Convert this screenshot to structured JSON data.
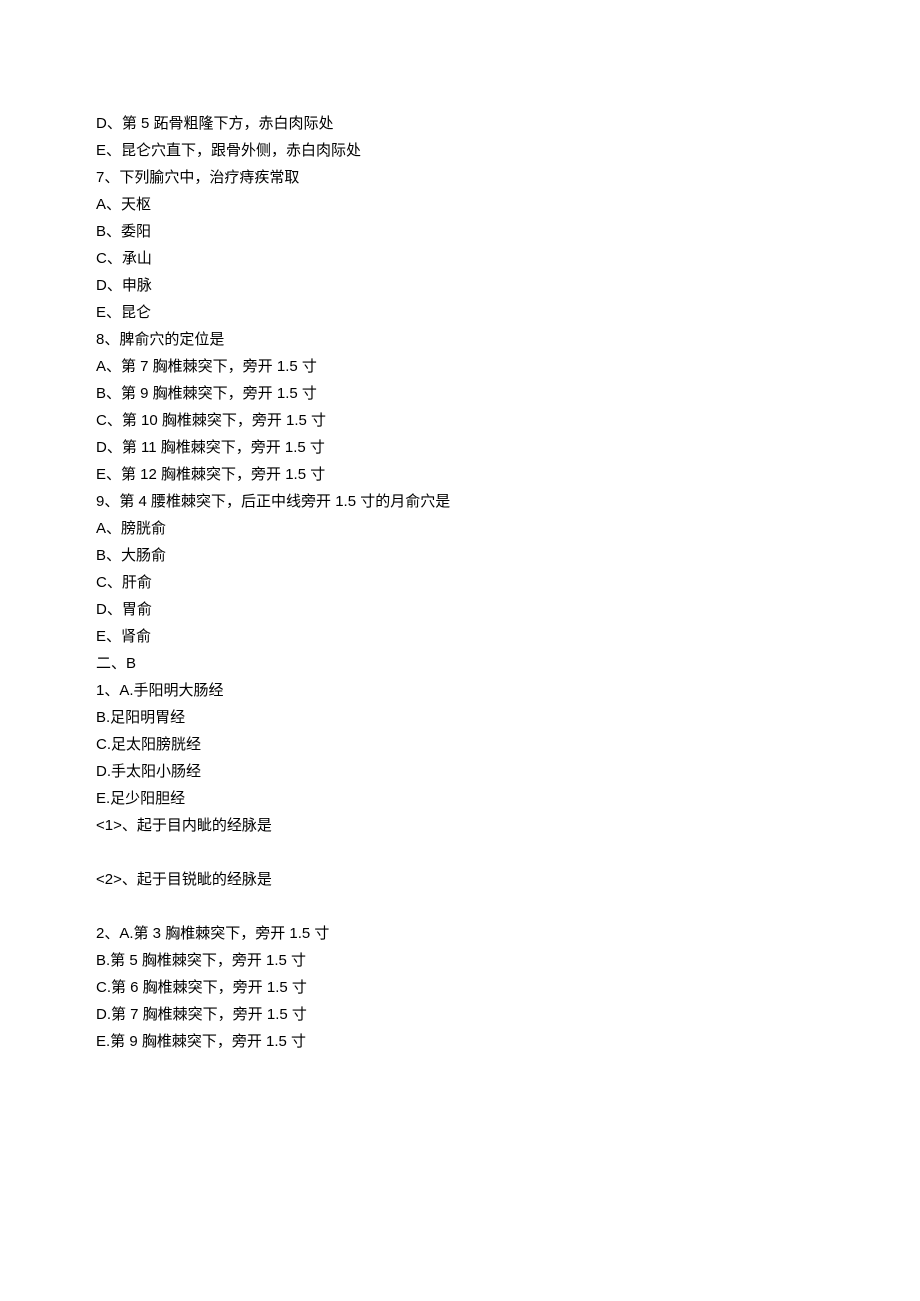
{
  "lines": [
    "D、第 5 跖骨粗隆下方，赤白肉际处",
    "E、昆仑穴直下，跟骨外侧，赤白肉际处",
    "7、下列腧穴中，治疗痔疾常取",
    "A、天枢",
    "B、委阳",
    "C、承山",
    "D、申脉",
    "E、昆仑",
    "8、脾俞穴的定位是",
    "A、第 7 胸椎棘突下，旁开 1.5 寸",
    "B、第 9 胸椎棘突下，旁开 1.5 寸",
    "C、第 10 胸椎棘突下，旁开 1.5 寸",
    "D、第 11 胸椎棘突下，旁开 1.5 寸",
    "E、第 12 胸椎棘突下，旁开 1.5 寸",
    "9、第 4 腰椎棘突下，后正中线旁开 1.5 寸的月俞穴是",
    "A、膀胱俞",
    "B、大肠俞",
    "C、肝俞",
    "D、胃俞",
    "E、肾俞",
    "二、B",
    "1、A.手阳明大肠经",
    "B.足阳明胃经",
    "C.足太阳膀胱经",
    "D.手太阳小肠经",
    "E.足少阳胆经",
    "<1>、起于目内眦的经脉是",
    "",
    "<2>、起于目锐眦的经脉是",
    "",
    "2、A.第 3 胸椎棘突下，旁开 1.5 寸",
    "B.第 5 胸椎棘突下，旁开 1.5 寸",
    "C.第 6 胸椎棘突下，旁开 1.5 寸",
    "D.第 7 胸椎棘突下，旁开 1.5 寸",
    "E.第 9 胸椎棘突下，旁开 1.5 寸"
  ]
}
